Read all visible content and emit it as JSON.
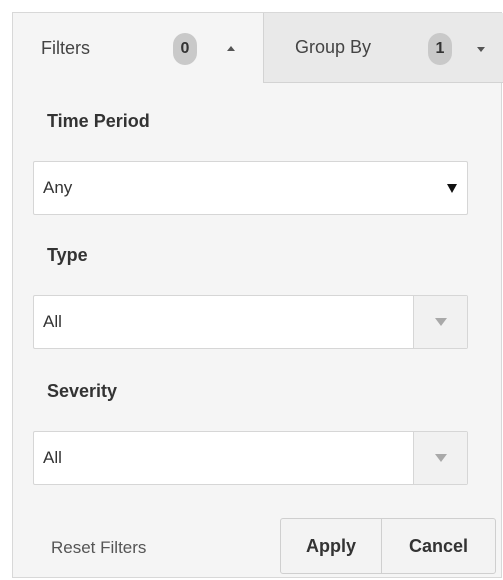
{
  "tabs": {
    "filters": {
      "label": "Filters",
      "count": "0",
      "expanded": true
    },
    "group_by": {
      "label": "Group By",
      "count": "1",
      "expanded": false
    }
  },
  "time_period": {
    "label": "Time Period",
    "value": "Any"
  },
  "type": {
    "label": "Type",
    "value": "All"
  },
  "severity": {
    "label": "Severity",
    "value": "All"
  },
  "actions": {
    "reset_label": "Reset Filters",
    "apply_label": "Apply",
    "cancel_label": "Cancel"
  },
  "colors": {
    "panel_bg": "#f5f5f5",
    "inactive_tab_bg": "#e9e9e9",
    "badge_bg": "#c9c9c9",
    "border": "#d6d6d6"
  },
  "icons": {
    "filters_caret": "caret-up-icon",
    "group_by_caret": "caret-down-icon",
    "time_period_arrow": "dropdown-arrow-icon",
    "type_arrow": "dropdown-arrow-icon",
    "severity_arrow": "dropdown-arrow-icon"
  }
}
